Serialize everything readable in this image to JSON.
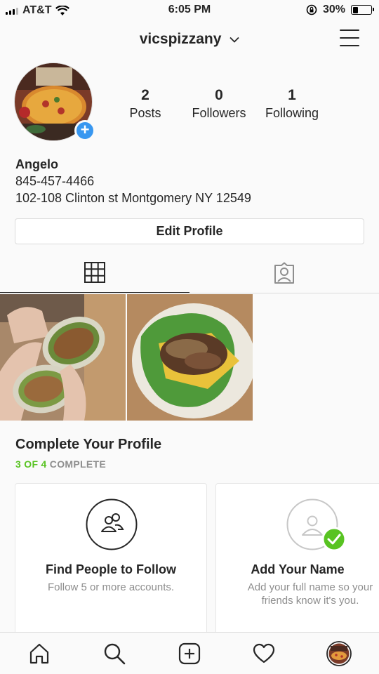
{
  "status_bar": {
    "carrier": "AT&T",
    "time": "6:05 PM",
    "battery": "30%"
  },
  "header": {
    "username": "vicspizzany"
  },
  "profile": {
    "stats": [
      {
        "num": "2",
        "label": "Posts"
      },
      {
        "num": "0",
        "label": "Followers"
      },
      {
        "num": "1",
        "label": "Following"
      }
    ],
    "name": "Angelo",
    "phone": "845-457-4466",
    "address": "102-108 Clinton st Montgomery NY 12549",
    "edit_label": "Edit Profile"
  },
  "complete_profile": {
    "title": "Complete Your Profile",
    "progress_done": "3 OF 4",
    "progress_suffix": "COMPLETE",
    "cards": [
      {
        "title": "Find People to Follow",
        "desc": "Follow 5 or more accounts."
      },
      {
        "title": "Add Your Name",
        "desc": "Add your full name so your friends know it's you."
      }
    ]
  },
  "colors": {
    "accent": "#3897f0",
    "success": "#58c322",
    "text": "#262626",
    "muted": "#8e8e8e"
  }
}
